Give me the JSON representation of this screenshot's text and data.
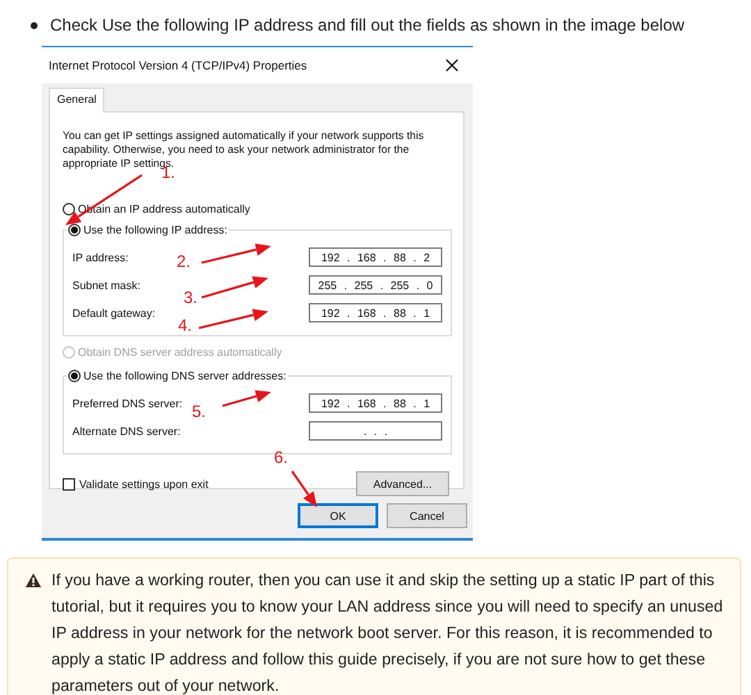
{
  "instruction": "Check Use the following IP address and fill out the fields as shown in the image below",
  "dialog": {
    "title": "Internet Protocol Version 4 (TCP/IPv4) Properties",
    "tabs": [
      {
        "label": "General",
        "selected": true
      }
    ],
    "intro": "You can get IP settings assigned automatically if your network supports this capability. Otherwise, you need to ask your network administrator for the appropriate IP settings.",
    "ip_options": [
      {
        "label": "Obtain an IP address automatically",
        "selected": false,
        "disabled": false
      },
      {
        "label": "Use the following IP address:",
        "selected": true,
        "disabled": false
      }
    ],
    "ip_fields": [
      {
        "label": "IP address:",
        "value": "192 . 168 . 88 . 2"
      },
      {
        "label": "Subnet mask:",
        "value": "255 . 255 . 255 . 0"
      },
      {
        "label": "Default gateway:",
        "value": "192 . 168 . 88 . 1"
      }
    ],
    "dns_options": [
      {
        "label": "Obtain DNS server address automatically",
        "selected": false,
        "disabled": true
      },
      {
        "label": "Use the following DNS server addresses:",
        "selected": true,
        "disabled": false
      }
    ],
    "dns_fields": [
      {
        "label": "Preferred DNS server:",
        "value": "192 . 168 . 88 . 1"
      },
      {
        "label": "Alternate DNS server:",
        "value": ". . ."
      }
    ],
    "validate": {
      "label": "Validate settings upon exit",
      "checked": false
    },
    "advanced_button": "Advanced...",
    "buttons": [
      {
        "label": "OK",
        "default": true
      },
      {
        "label": "Cancel",
        "default": false
      }
    ],
    "annotations": [
      {
        "label": "1."
      },
      {
        "label": "2."
      },
      {
        "label": "3."
      },
      {
        "label": "4."
      },
      {
        "label": "5."
      },
      {
        "label": "6."
      }
    ]
  },
  "notice": {
    "text": "If you have a working router, then you can use it and skip the setting up a static IP part of this tutorial, but it requires you to know your LAN address since you will need to specify an unused IP address in your network for the network boot server. For this reason, it is recommended to apply a static IP address and follow this guide precisely, if you are not sure how to get these parameters out of your network."
  }
}
